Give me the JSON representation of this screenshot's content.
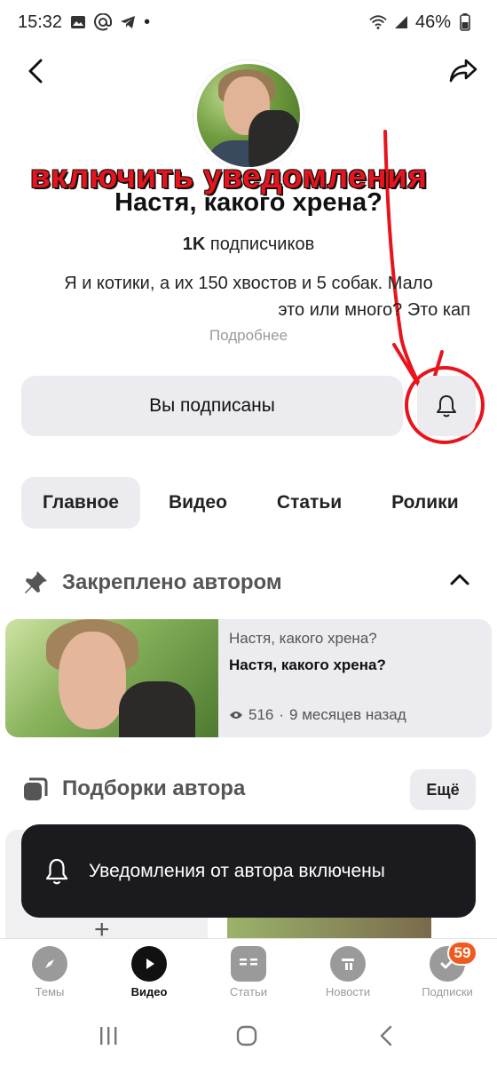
{
  "status_bar": {
    "time": "15:32",
    "dot": "•",
    "battery": "46%"
  },
  "annotation": {
    "text": "включить уведомления"
  },
  "channel": {
    "title": "Настя, какого хрена?",
    "subscribers_count": "1K",
    "subscribers_label": "подписчиков",
    "description_line1": "Я и котики, а их 150 хвостов и 5 собак. Мало",
    "description_line2": "это или много? Это кап",
    "more_label": "Подробнее"
  },
  "actions": {
    "subscribed_label": "Вы подписаны"
  },
  "tabs": [
    {
      "label": "Главное",
      "active": true
    },
    {
      "label": "Видео",
      "active": false
    },
    {
      "label": "Статьи",
      "active": false
    },
    {
      "label": "Ролики",
      "active": false
    }
  ],
  "pinned": {
    "title": "Закреплено автором",
    "card": {
      "channel": "Настя, какого хрена?",
      "title": "Настя, какого хрена?",
      "views": "516",
      "separator": "·",
      "age": "9 месяцев назад"
    }
  },
  "collections": {
    "title": "Подборки автора",
    "more_label": "Ещё"
  },
  "toast": {
    "text": "Уведомления от автора включены"
  },
  "bottom_nav": {
    "items": [
      {
        "label": "Темы",
        "icon": "compass-icon"
      },
      {
        "label": "Видео",
        "icon": "play-icon",
        "active": true
      },
      {
        "label": "Статьи",
        "icon": "articles-icon"
      },
      {
        "label": "Новости",
        "icon": "news-icon"
      },
      {
        "label": "Подписки",
        "icon": "subscriptions-icon",
        "badge": "59"
      }
    ]
  },
  "colors": {
    "accent_red": "#e8141d",
    "badge": "#f05a1e",
    "chip_bg": "#ebebf0",
    "toast_bg": "#1b1b1f"
  }
}
